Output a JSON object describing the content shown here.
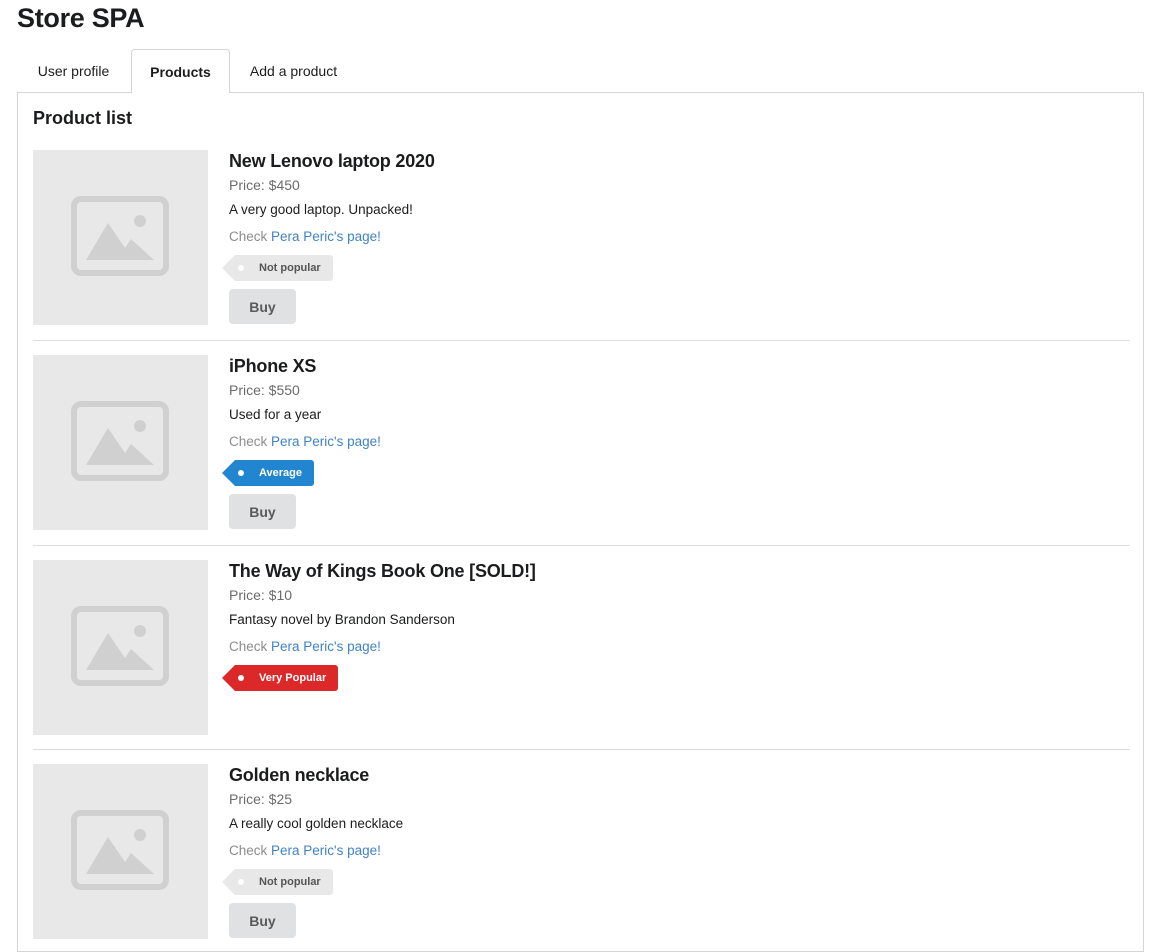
{
  "app": {
    "title": "Store SPA"
  },
  "tabs": [
    {
      "label": "User profile",
      "active": false
    },
    {
      "label": "Products",
      "active": true
    },
    {
      "label": "Add a product",
      "active": false
    }
  ],
  "product_list": {
    "title": "Product list",
    "items": [
      {
        "name": "New Lenovo laptop 2020",
        "price": "Price: $450",
        "description": "A very good laptop. Unpacked!",
        "owner_prefix": "Check ",
        "owner_link": "Pera Peric's page!",
        "popularity": "Not popular",
        "popularity_color": "#e8e8e8",
        "buy_label": "Buy",
        "image_icon": "image-placeholder-icon"
      },
      {
        "name": "iPhone XS",
        "price": "Price: $550",
        "description": "Used for a year",
        "owner_prefix": "Check ",
        "owner_link": "Pera Peric's page!",
        "popularity": "Average",
        "popularity_color": "#2185d0",
        "buy_label": "Buy",
        "image_icon": "image-placeholder-icon"
      },
      {
        "name": "The Way of Kings Book One [SOLD!]",
        "price": "Price: $10",
        "description": "Fantasy novel by Brandon Sanderson",
        "owner_prefix": "Check ",
        "owner_link": "Pera Peric's page!",
        "popularity": "Very Popular",
        "popularity_color": "#db2828",
        "image_icon": "image-placeholder-icon"
      },
      {
        "name": "Golden necklace",
        "price": "Price: $25",
        "description": "A really cool golden necklace",
        "owner_prefix": "Check ",
        "owner_link": "Pera Peric's page!",
        "popularity": "Not popular",
        "popularity_color": "#e8e8e8",
        "buy_label": "Buy",
        "image_icon": "image-placeholder-icon"
      }
    ]
  },
  "colors": {
    "link": "#4183c4",
    "button_bg": "#e0e1e2",
    "placeholder_bg": "#e8e8e8"
  }
}
